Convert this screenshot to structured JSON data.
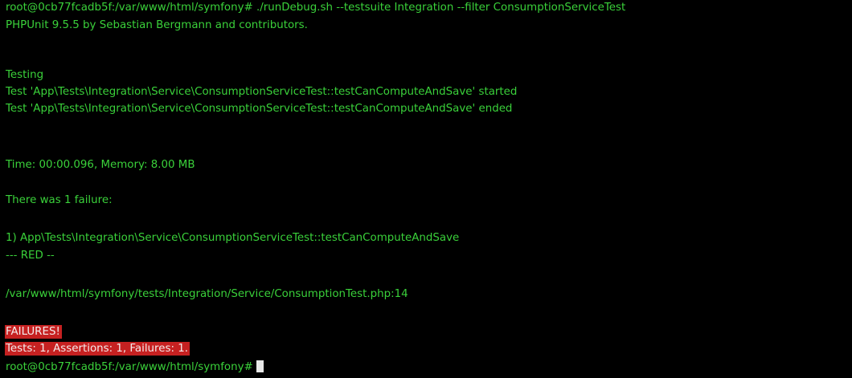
{
  "colors": {
    "background": "#000000",
    "text": "#3ad13a",
    "failure_highlight": "#c62121",
    "failure_text": "#f4ecec",
    "cursor": "#e8e8e8"
  },
  "terminal": {
    "command_line": "root@0cb77fcadb5f:/var/www/html/symfony# ./runDebug.sh --testsuite Integration --filter ConsumptionServiceTest",
    "version_line": "PHPUnit 9.5.5 by Sebastian Bergmann and contributors.",
    "testing_label": "Testing",
    "test_started_line": "Test 'App\\Tests\\Integration\\Service\\ConsumptionServiceTest::testCanComputeAndSave' started",
    "test_ended_line": "Test 'App\\Tests\\Integration\\Service\\ConsumptionServiceTest::testCanComputeAndSave' ended",
    "time_memory_line": "Time: 00:00.096, Memory: 8.00 MB",
    "failure_count_line": "There was 1 failure:",
    "failure_item_line": "1) App\\Tests\\Integration\\Service\\ConsumptionServiceTest::testCanComputeAndSave",
    "failure_message_line": "--- RED --",
    "failure_location_line": "/var/www/html/symfony/tests/Integration/Service/ConsumptionTest.php:14",
    "failures_banner": "FAILURES!",
    "summary_line": "Tests: 1, Assertions: 1, Failures: 1.",
    "prompt": "root@0cb77fcadb5f:/var/www/html/symfony#"
  }
}
